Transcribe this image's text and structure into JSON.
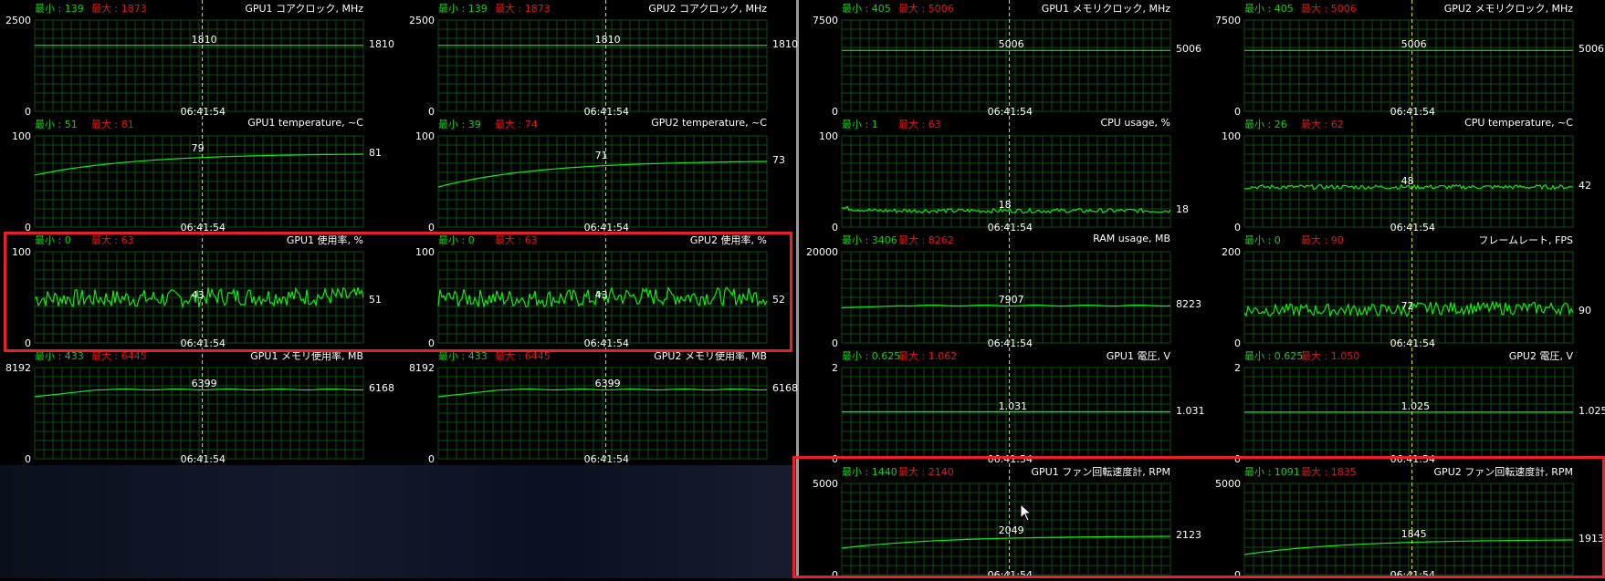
{
  "app": {
    "time_stamp": "06:41:54"
  },
  "colors": {
    "grid": "#0d4f12",
    "line": "#17e617",
    "cursor_line": "#e6e61a",
    "min_label": "#1ec81e",
    "max_label": "#e01818",
    "highlight": "#e8202a"
  },
  "highlights": [
    "GPU usage graphs",
    "GPU fan speed graphs"
  ],
  "graphs": [
    {
      "id": "gpu1-core-clock",
      "title": "GPU1 コアクロック, MHz",
      "min_text": "最小 : 139",
      "max_text": "最大 : 1873",
      "ymax": "2500",
      "ymin": "0",
      "current": "1810",
      "cursor_value": "1810",
      "time": "06:41:54",
      "kind": "flat",
      "level": 0.723
    },
    {
      "id": "gpu2-core-clock",
      "title": "GPU2 コアクロック, MHz",
      "min_text": "最小 : 139",
      "max_text": "最大 : 1873",
      "ymax": "2500",
      "ymin": "0",
      "current": "1810",
      "cursor_value": "1810",
      "time": "06:41:54",
      "kind": "flat",
      "level": 0.723
    },
    {
      "id": "gpu1-temperature",
      "title": "GPU1 temperature, ~C",
      "min_text": "最小 : 51",
      "max_text": "最大 : 81",
      "ymax": "100",
      "ymin": "0",
      "current": "81",
      "cursor_value": "79",
      "time": "06:41:54",
      "kind": "rise",
      "level_start": 0.57,
      "level": 0.8
    },
    {
      "id": "gpu2-temperature",
      "title": "GPU2 temperature, ~C",
      "min_text": "最小 : 39",
      "max_text": "最大 : 74",
      "ymax": "100",
      "ymin": "0",
      "current": "73",
      "cursor_value": "71",
      "time": "06:41:54",
      "kind": "rise",
      "level_start": 0.44,
      "level": 0.72
    },
    {
      "id": "gpu1-usage",
      "title": "GPU1 使用率, %",
      "min_text": "最小 : 0",
      "max_text": "最大 : 63",
      "ymax": "100",
      "ymin": "0",
      "current": "51",
      "cursor_value": "43",
      "time": "06:41:54",
      "kind": "noisy",
      "level": 0.46,
      "amp": 0.1
    },
    {
      "id": "gpu2-usage",
      "title": "GPU2 使用率, %",
      "min_text": "最小 : 0",
      "max_text": "最大 : 63",
      "ymax": "100",
      "ymin": "0",
      "current": "52",
      "cursor_value": "43",
      "time": "06:41:54",
      "kind": "noisy",
      "level": 0.46,
      "amp": 0.1
    },
    {
      "id": "gpu1-memory-usage",
      "title": "GPU1 メモリ使用率, MB",
      "min_text": "最小 : 433",
      "max_text": "最大 : 6445",
      "ymax": "8192",
      "ymin": "0",
      "current": "6168",
      "cursor_value": "6399",
      "time": "06:41:54",
      "kind": "plateau",
      "level_start": 0.68,
      "level": 0.76
    },
    {
      "id": "gpu2-memory-usage",
      "title": "GPU2 メモリ使用率, MB",
      "min_text": "最小 : 433",
      "max_text": "最大 : 6445",
      "ymax": "8192",
      "ymin": "0",
      "current": "6168",
      "cursor_value": "6399",
      "time": "06:41:54",
      "kind": "plateau",
      "level_start": 0.68,
      "level": 0.76
    },
    {
      "id": "gpu1-memory-clock",
      "title": "GPU1 メモリクロック, MHz",
      "min_text": "最小 : 405",
      "max_text": "最大 : 5006",
      "ymax": "7500",
      "ymin": "0",
      "current": "5006",
      "cursor_value": "5006",
      "time": "06:41:54",
      "kind": "flat",
      "level": 0.667
    },
    {
      "id": "gpu2-memory-clock",
      "title": "GPU2 メモリクロック, MHz",
      "min_text": "最小 : 405",
      "max_text": "最大 : 5006",
      "ymax": "7500",
      "ymin": "0",
      "current": "5006",
      "cursor_value": "5006",
      "time": "06:41:54",
      "kind": "flat",
      "level": 0.667
    },
    {
      "id": "cpu-usage",
      "title": "CPU usage, %",
      "min_text": "最小 : 1",
      "max_text": "最大 : 63",
      "ymax": "100",
      "ymin": "0",
      "current": "18",
      "cursor_value": "18",
      "time": "06:41:54",
      "kind": "lownoise",
      "level": 0.18,
      "amp": 0.03
    },
    {
      "id": "cpu-temperature",
      "title": "CPU temperature, ~C",
      "min_text": "最小 : 26",
      "max_text": "最大 : 62",
      "ymax": "100",
      "ymin": "0",
      "current": "42",
      "cursor_value": "48",
      "time": "06:41:54",
      "kind": "lownoise",
      "level": 0.44,
      "amp": 0.03
    },
    {
      "id": "ram-usage",
      "title": "RAM usage, MB",
      "min_text": "最小 : 3406",
      "max_text": "最大 : 8262",
      "ymax": "20000",
      "ymin": "0",
      "current": "8223",
      "cursor_value": "7907",
      "time": "06:41:54",
      "kind": "plateau",
      "level_start": 0.385,
      "level": 0.41
    },
    {
      "id": "framerate",
      "title": "フレームレート, FPS",
      "min_text": "最小 : 0",
      "max_text": "最大 : 90",
      "ymax": "200",
      "ymin": "0",
      "current": "90",
      "cursor_value": "72",
      "time": "06:41:54",
      "kind": "noisy",
      "level": 0.34,
      "amp": 0.07
    },
    {
      "id": "gpu1-voltage",
      "title": "GPU1 電圧, V",
      "min_text": "最小 : 0.625",
      "max_text": "最大 : 1.062",
      "ymax": "2",
      "ymin": "0",
      "current": "1.031",
      "cursor_value": "1.031",
      "time": "06:41:54",
      "kind": "flat",
      "level": 0.515
    },
    {
      "id": "gpu2-voltage",
      "title": "GPU2 電圧, V",
      "min_text": "最小 : 0.625",
      "max_text": "最大 : 1.050",
      "ymax": "2",
      "ymin": "0",
      "current": "1.025",
      "cursor_value": "1.025",
      "time": "06:41:54",
      "kind": "flat",
      "level": 0.512
    },
    {
      "id": "gpu1-fan-speed",
      "title": "GPU1 ファン回転速度計, RPM",
      "min_text": "最小 : 1440",
      "max_text": "最大 : 2140",
      "ymax": "5000",
      "ymin": "0",
      "current": "2123",
      "cursor_value": "2049",
      "time": "06:41:54",
      "kind": "rise",
      "level_start": 0.29,
      "level": 0.42
    },
    {
      "id": "gpu2-fan-speed",
      "title": "GPU2 ファン回転速度計, RPM",
      "min_text": "最小 : 1091",
      "max_text": "最大 : 1835",
      "ymax": "5000",
      "ymin": "0",
      "current": "1913",
      "cursor_value": "1845",
      "time": "06:41:54",
      "kind": "rise",
      "level_start": 0.22,
      "level": 0.38
    }
  ]
}
